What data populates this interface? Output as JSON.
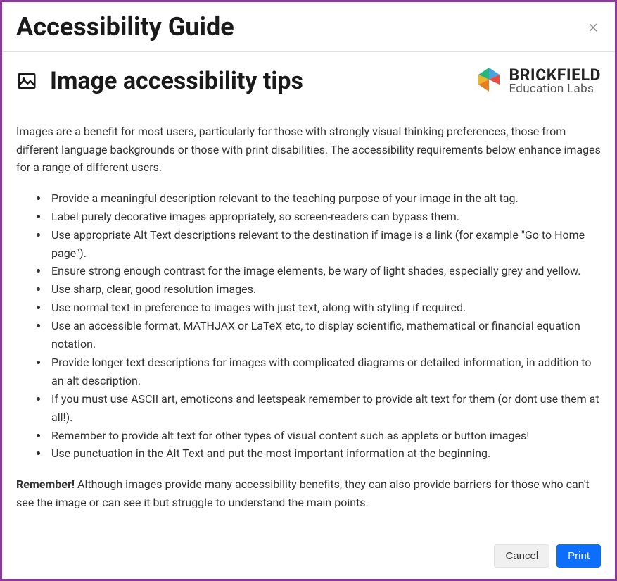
{
  "modal": {
    "title": "Accessibility Guide",
    "close_label": "×"
  },
  "content": {
    "title": "Image accessibility tips",
    "intro": "Images are a benefit for most users, particularly for those with strongly visual thinking preferences, those from different language backgrounds or those with print disabilities. The accessibility requirements below enhance images for a range of different users.",
    "tips": [
      "Provide a meaningful description relevant to the teaching purpose of your image in the alt tag.",
      "Label purely decorative images appropriately, so screen-readers can bypass them.",
      "Use appropriate Alt Text descriptions relevant to the destination if image is a link (for example \"Go to Home page\").",
      "Ensure strong enough contrast for the image elements, be wary of light shades, especially grey and yellow.",
      "Use sharp, clear, good resolution images.",
      "Use normal text in preference to images with just text, along with styling if required.",
      "Use an accessible format, MATHJAX or LaTeX etc, to display scientific, mathematical or financial equation notation.",
      "Provide longer text descriptions for images with complicated diagrams or detailed information, in addition to an alt description.",
      "If you must use ASCII art, emoticons and leetspeak remember to provide alt text for them (or dont use them at all!).",
      "Remember to provide alt text for other types of visual content such as applets or button images!",
      "Use punctuation in the Alt Text and put the most important information at the beginning."
    ],
    "remember_label": "Remember!",
    "remember_text": " Although images provide many accessibility benefits, they can also provide barriers for those who can't see the image or can see it but struggle to understand the main points."
  },
  "brand": {
    "name": "BRICKFIELD",
    "tagline": "Education Labs"
  },
  "footer": {
    "cancel_label": "Cancel",
    "print_label": "Print"
  }
}
